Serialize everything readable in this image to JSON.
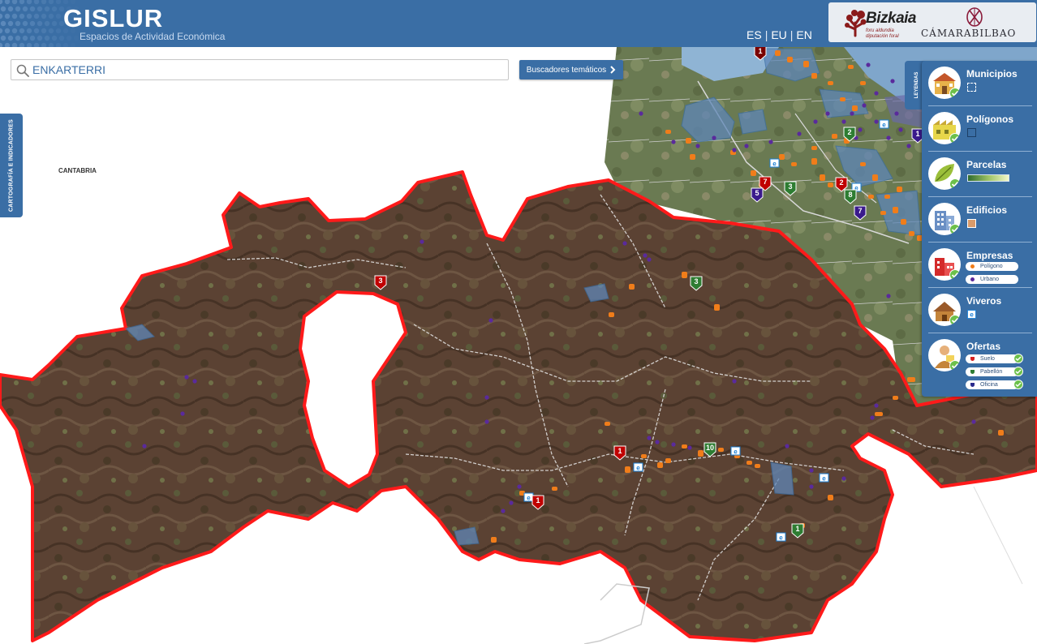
{
  "header": {
    "title": "GISLUR",
    "subtitle": "Espacios de Actividad Económica",
    "languages": [
      "ES",
      "EU",
      "EN"
    ],
    "separator": "|",
    "logos": {
      "bizkaia": "Bizkaia",
      "bizkaia_tagline_1": "foru aldundia",
      "bizkaia_tagline_2": "diputación foral",
      "camara": "CÁMARABILBAO"
    }
  },
  "search": {
    "value": "ENKARTERRI",
    "button_label": "Buscadores temáticos"
  },
  "left_tab": {
    "label": "CARTOGRAFÍA E INDICADORES"
  },
  "map": {
    "region_label": "CANTABRIA",
    "boundary_color": "#ff1a1a",
    "markers": [
      {
        "label": "1",
        "color": "#7a0000"
      },
      {
        "label": "2",
        "color": "#2e7d32"
      },
      {
        "label": "7",
        "color": "#c00000"
      },
      {
        "label": "5",
        "color": "#3a1a8c"
      },
      {
        "label": "3",
        "color": "#2e7d32"
      },
      {
        "label": "2",
        "color": "#c00000"
      },
      {
        "label": "8",
        "color": "#2e7d32"
      },
      {
        "label": "7",
        "color": "#3a1a8c"
      },
      {
        "label": "1",
        "color": "#3a1a8c"
      },
      {
        "label": "3",
        "color": "#c00000"
      },
      {
        "label": "3",
        "color": "#2e7d32"
      },
      {
        "label": "1",
        "color": "#c00000"
      },
      {
        "label": "10",
        "color": "#2e7d32"
      },
      {
        "label": "1",
        "color": "#c00000"
      },
      {
        "label": "1",
        "color": "#2e7d32"
      },
      {
        "label": "1",
        "color": "#3a1a8c"
      }
    ]
  },
  "legend": {
    "tab_label": "LEYENDAS",
    "items": [
      {
        "name": "Municipios"
      },
      {
        "name": "Polígonos"
      },
      {
        "name": "Parcelas"
      },
      {
        "name": "Edificios"
      },
      {
        "name": "Empresas",
        "sub": [
          "Polígono",
          "Urbano"
        ]
      },
      {
        "name": "Viveros"
      },
      {
        "name": "Ofertas",
        "sub": [
          "Suelo",
          "Pabellón",
          "Oficina"
        ]
      }
    ],
    "colors": {
      "poligono": "#f07d1a",
      "urbano": "#5a2a9c",
      "suelo": "#d62020",
      "pabellon": "#2e7d32",
      "oficina": "#2a2a8c"
    }
  }
}
